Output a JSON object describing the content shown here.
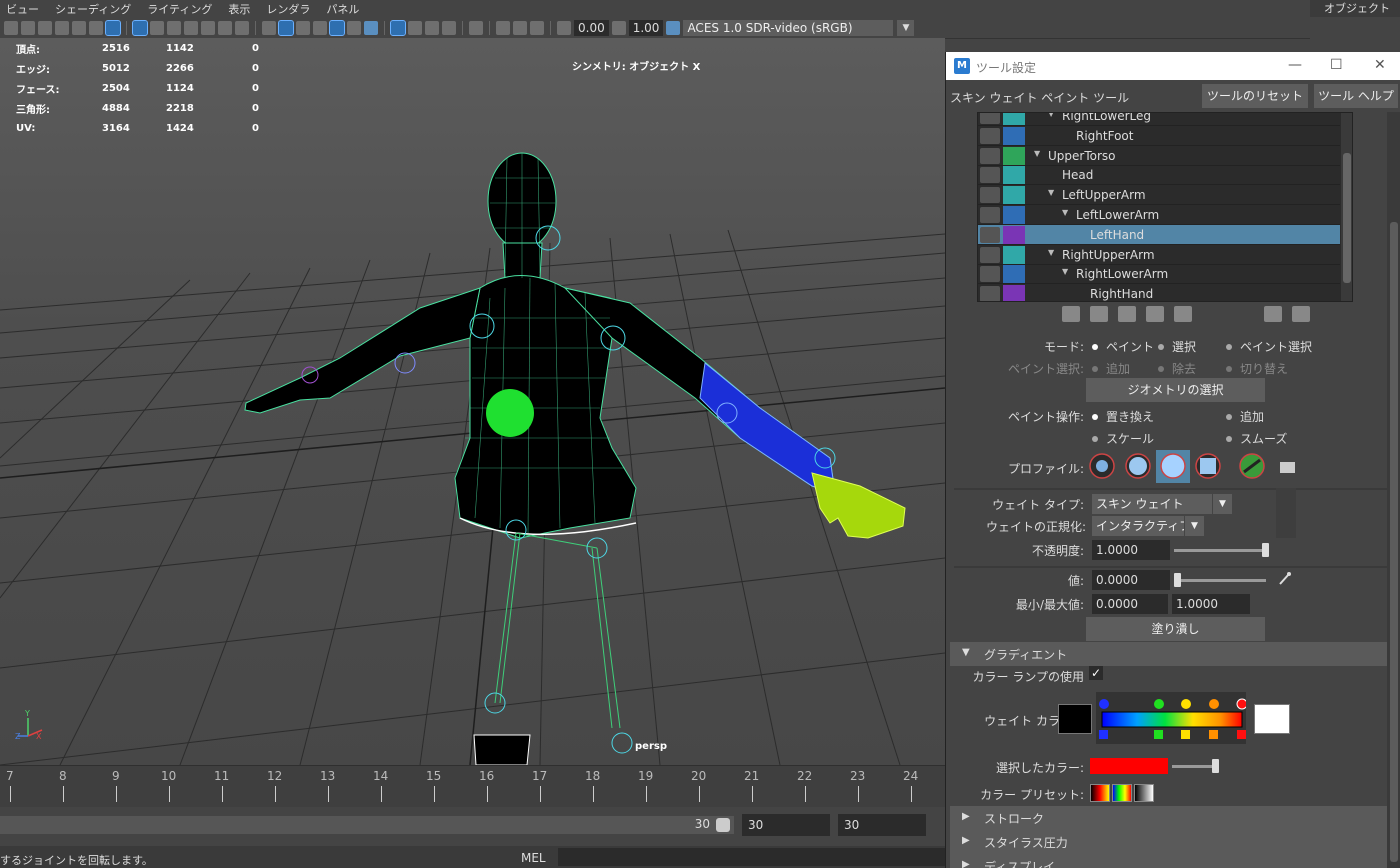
{
  "menubar": {
    "items": [
      "ビュー",
      "シェーディング",
      "ライティング",
      "表示",
      "レンダラ",
      "パネル"
    ],
    "right_label": "オブジェクト"
  },
  "viewport_toolbar": {
    "exposure": "0.00",
    "gamma": "1.00",
    "color_space": "ACES 1.0 SDR-video (sRGB)"
  },
  "hud": {
    "rows": [
      {
        "label": "頂点:",
        "a": "2516",
        "b": "1142",
        "c": "0"
      },
      {
        "label": "エッジ:",
        "a": "5012",
        "b": "2266",
        "c": "0"
      },
      {
        "label": "フェース:",
        "a": "2504",
        "b": "1124",
        "c": "0"
      },
      {
        "label": "三角形:",
        "a": "4884",
        "b": "2218",
        "c": "0"
      },
      {
        "label": "UV:",
        "a": "3164",
        "b": "1424",
        "c": "0"
      }
    ],
    "symmetry": "シンメトリ: オブジェクト X",
    "camera": "persp"
  },
  "timeline": {
    "ticks": [
      "7",
      "8",
      "9",
      "10",
      "11",
      "12",
      "13",
      "14",
      "15",
      "16",
      "17",
      "18",
      "19",
      "20",
      "21",
      "22",
      "23",
      "24"
    ]
  },
  "range": {
    "end_value": "30",
    "field1": "30",
    "field2": "30"
  },
  "status": {
    "help_text": "するジョイントを回転します。",
    "mel_label": "MEL"
  },
  "tool_window": {
    "title": "ツール設定",
    "tool_name": "スキン ウェイト ペイント ツール",
    "reset_button": "ツールのリセット",
    "help_button": "ツール ヘルプ",
    "influences": [
      {
        "name": "RightLowerLeg",
        "indent": 3,
        "arrow": true,
        "color": "#30a8a8",
        "selected": false
      },
      {
        "name": "RightFoot",
        "indent": 4,
        "arrow": false,
        "color": "#2f6db5",
        "selected": false
      },
      {
        "name": "UpperTorso",
        "indent": 2,
        "arrow": true,
        "color": "#2fa55a",
        "selected": false
      },
      {
        "name": "Head",
        "indent": 3,
        "arrow": false,
        "color": "#30a8a8",
        "selected": false
      },
      {
        "name": "LeftUpperArm",
        "indent": 3,
        "arrow": true,
        "color": "#30a8a8",
        "selected": false
      },
      {
        "name": "LeftLowerArm",
        "indent": 4,
        "arrow": true,
        "color": "#2f6db5",
        "selected": false
      },
      {
        "name": "LeftHand",
        "indent": 5,
        "arrow": false,
        "color": "#7a35b5",
        "selected": true
      },
      {
        "name": "RightUpperArm",
        "indent": 3,
        "arrow": true,
        "color": "#30a8a8",
        "selected": false
      },
      {
        "name": "RightLowerArm",
        "indent": 4,
        "arrow": true,
        "color": "#2f6db5",
        "selected": false
      },
      {
        "name": "RightHand",
        "indent": 5,
        "arrow": false,
        "color": "#7a35b5",
        "selected": false
      }
    ],
    "mode": {
      "label": "モード:",
      "paint": "ペイント",
      "select": "選択",
      "paint_select": "ペイント選択"
    },
    "paint_select": {
      "label": "ペイント選択:",
      "add": "追加",
      "remove": "除去",
      "toggle": "切り替え"
    },
    "select_geometry_button": "ジオメトリの選択",
    "paint_operation": {
      "label": "ペイント操作:",
      "replace": "置き換え",
      "add": "追加",
      "scale": "スケール",
      "smooth": "スムーズ"
    },
    "profile_label": "プロファイル:",
    "weight_type": {
      "label": "ウェイト タイプ:",
      "value": "スキン ウェイト"
    },
    "normalize": {
      "label": "ウェイトの正規化:",
      "value": "インタラクティブ"
    },
    "opacity": {
      "label": "不透明度:",
      "value": "1.0000",
      "level": 1.0
    },
    "value": {
      "label": "値:",
      "value": "0.0000",
      "level": 0.0
    },
    "minmax": {
      "label": "最小/最大値:",
      "min": "0.0000",
      "max": "1.0000"
    },
    "flood_button": "塗り潰し",
    "gradient": {
      "section_title": "グラディエント",
      "use_color_ramp": "カラー ランプの使用",
      "weight_color_label": "ウェイト カラー:",
      "selected_color_label": "選択したカラー:",
      "selected_color": "#ff0000",
      "color_preset_label": "カラー プリセット:"
    },
    "sections": [
      "ストローク",
      "スタイラス圧力",
      "ディスプレイ"
    ]
  }
}
